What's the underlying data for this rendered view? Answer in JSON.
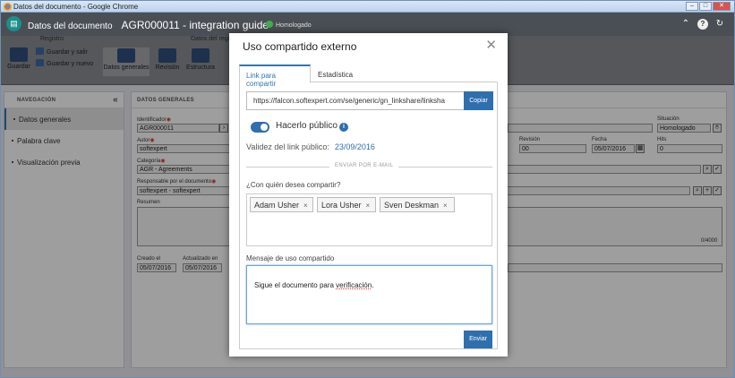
{
  "window": {
    "title": "Datos del documento - Google Chrome"
  },
  "app": {
    "section": "Datos del documento",
    "doc_title": "AGR000011 - integration guide",
    "status": "Homologado"
  },
  "ribbon": {
    "group_registro": "Registro",
    "group_datos": "Datos del regis",
    "save": "Guardar",
    "save_exit": "Guardar y salir",
    "save_new": "Guardar y nuevo",
    "general": "Datos generales",
    "revision": "Revisión",
    "structure": "Estructura"
  },
  "sidebar": {
    "header": "NAVEGACIÓN",
    "items": [
      {
        "label": "Datos generales"
      },
      {
        "label": "Palabra clave"
      },
      {
        "label": "Visualización previa"
      }
    ]
  },
  "main": {
    "header": "DATOS GENERALES",
    "identifier_label": "Identificador",
    "identifier": "AGR000011",
    "author_label": "Autor",
    "author": "softexpert",
    "category_label": "Categoría",
    "category": "AGR - Agreements",
    "responsible_label": "Responsable por el documento",
    "responsible": "softexpert - softexpert",
    "summary_label": "Resumen",
    "counter": "0/4000",
    "created_label": "Creado el",
    "created": "05/07/2016",
    "updated_label": "Actualizado en",
    "updated": "05/07/2016",
    "situation_label": "Situación",
    "situation": "Homologado",
    "revision_label": "Revisión",
    "revision": "00",
    "date_label": "Fecha",
    "date": "05/07/2016",
    "hits_label": "Hits",
    "hits": "0"
  },
  "dialog": {
    "title": "Uso compartido externo",
    "tabs": [
      {
        "label": "Link para compartir"
      },
      {
        "label": "Estadística"
      }
    ],
    "link": "https://falcon.softexpert.com/se/generic/gn_linkshare/linksha",
    "copy": "Copiar",
    "public_label": "Hacerlo público",
    "valid_label": "Validez del link público:",
    "valid_date": "23/09/2016",
    "email_sep": "ENVIAR POR E-MAIL",
    "share_question": "¿Con quién desea compartir?",
    "recipients": [
      {
        "name": "Adam Usher"
      },
      {
        "name": "Lora Usher"
      },
      {
        "name": "Sven Deskman"
      }
    ],
    "message_label": "Mensaje de uso compartido",
    "message_pre": "Sigue el documento para ",
    "message_word": "verificación",
    "message_post": ".",
    "send": "Enviar"
  }
}
